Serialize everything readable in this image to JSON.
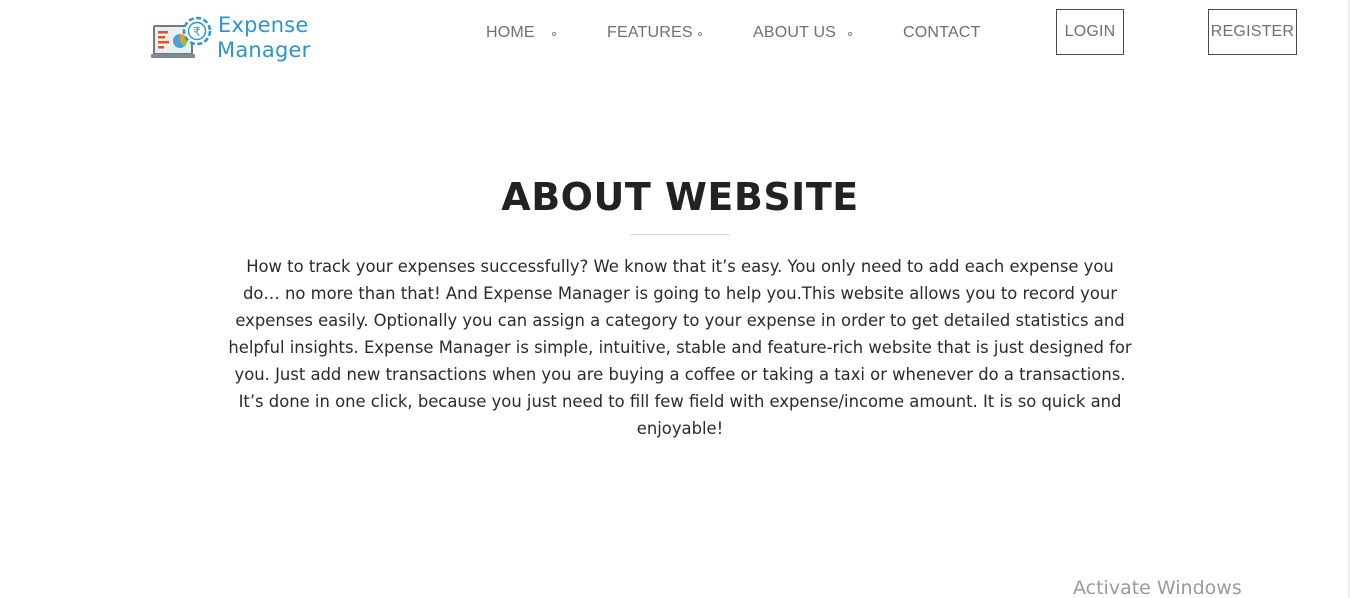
{
  "brand": {
    "line1": "Expense",
    "line2": "Manager",
    "logo_icon": "laptop-chart-rupee-icon",
    "color": "#2d95c9"
  },
  "nav": {
    "items": [
      {
        "label": "HOME"
      },
      {
        "label": "FEATURES"
      },
      {
        "label": "ABOUT US"
      },
      {
        "label": "CONTACT"
      }
    ],
    "login_label": "LOGIN",
    "register_label": "REGISTER"
  },
  "about": {
    "title": "ABOUT WEBSITE",
    "body": "How to track your expenses successfully? We know that it’s easy. You only need to add each expense you do… no more than that! And Expense Manager is going to help you.This website allows you to record your expenses easily. Optionally you can assign a category to your expense in order to get detailed statistics and helpful insights. Expense Manager is simple, intuitive, stable and feature-rich website that is just designed for you. Just add new transactions when you are buying a coffee or taking a taxi or whenever do a transactions. It’s done in one click, because you just need to fill few field with expense/income amount. It is so quick and enjoyable!"
  },
  "system": {
    "watermark": "Activate Windows"
  }
}
